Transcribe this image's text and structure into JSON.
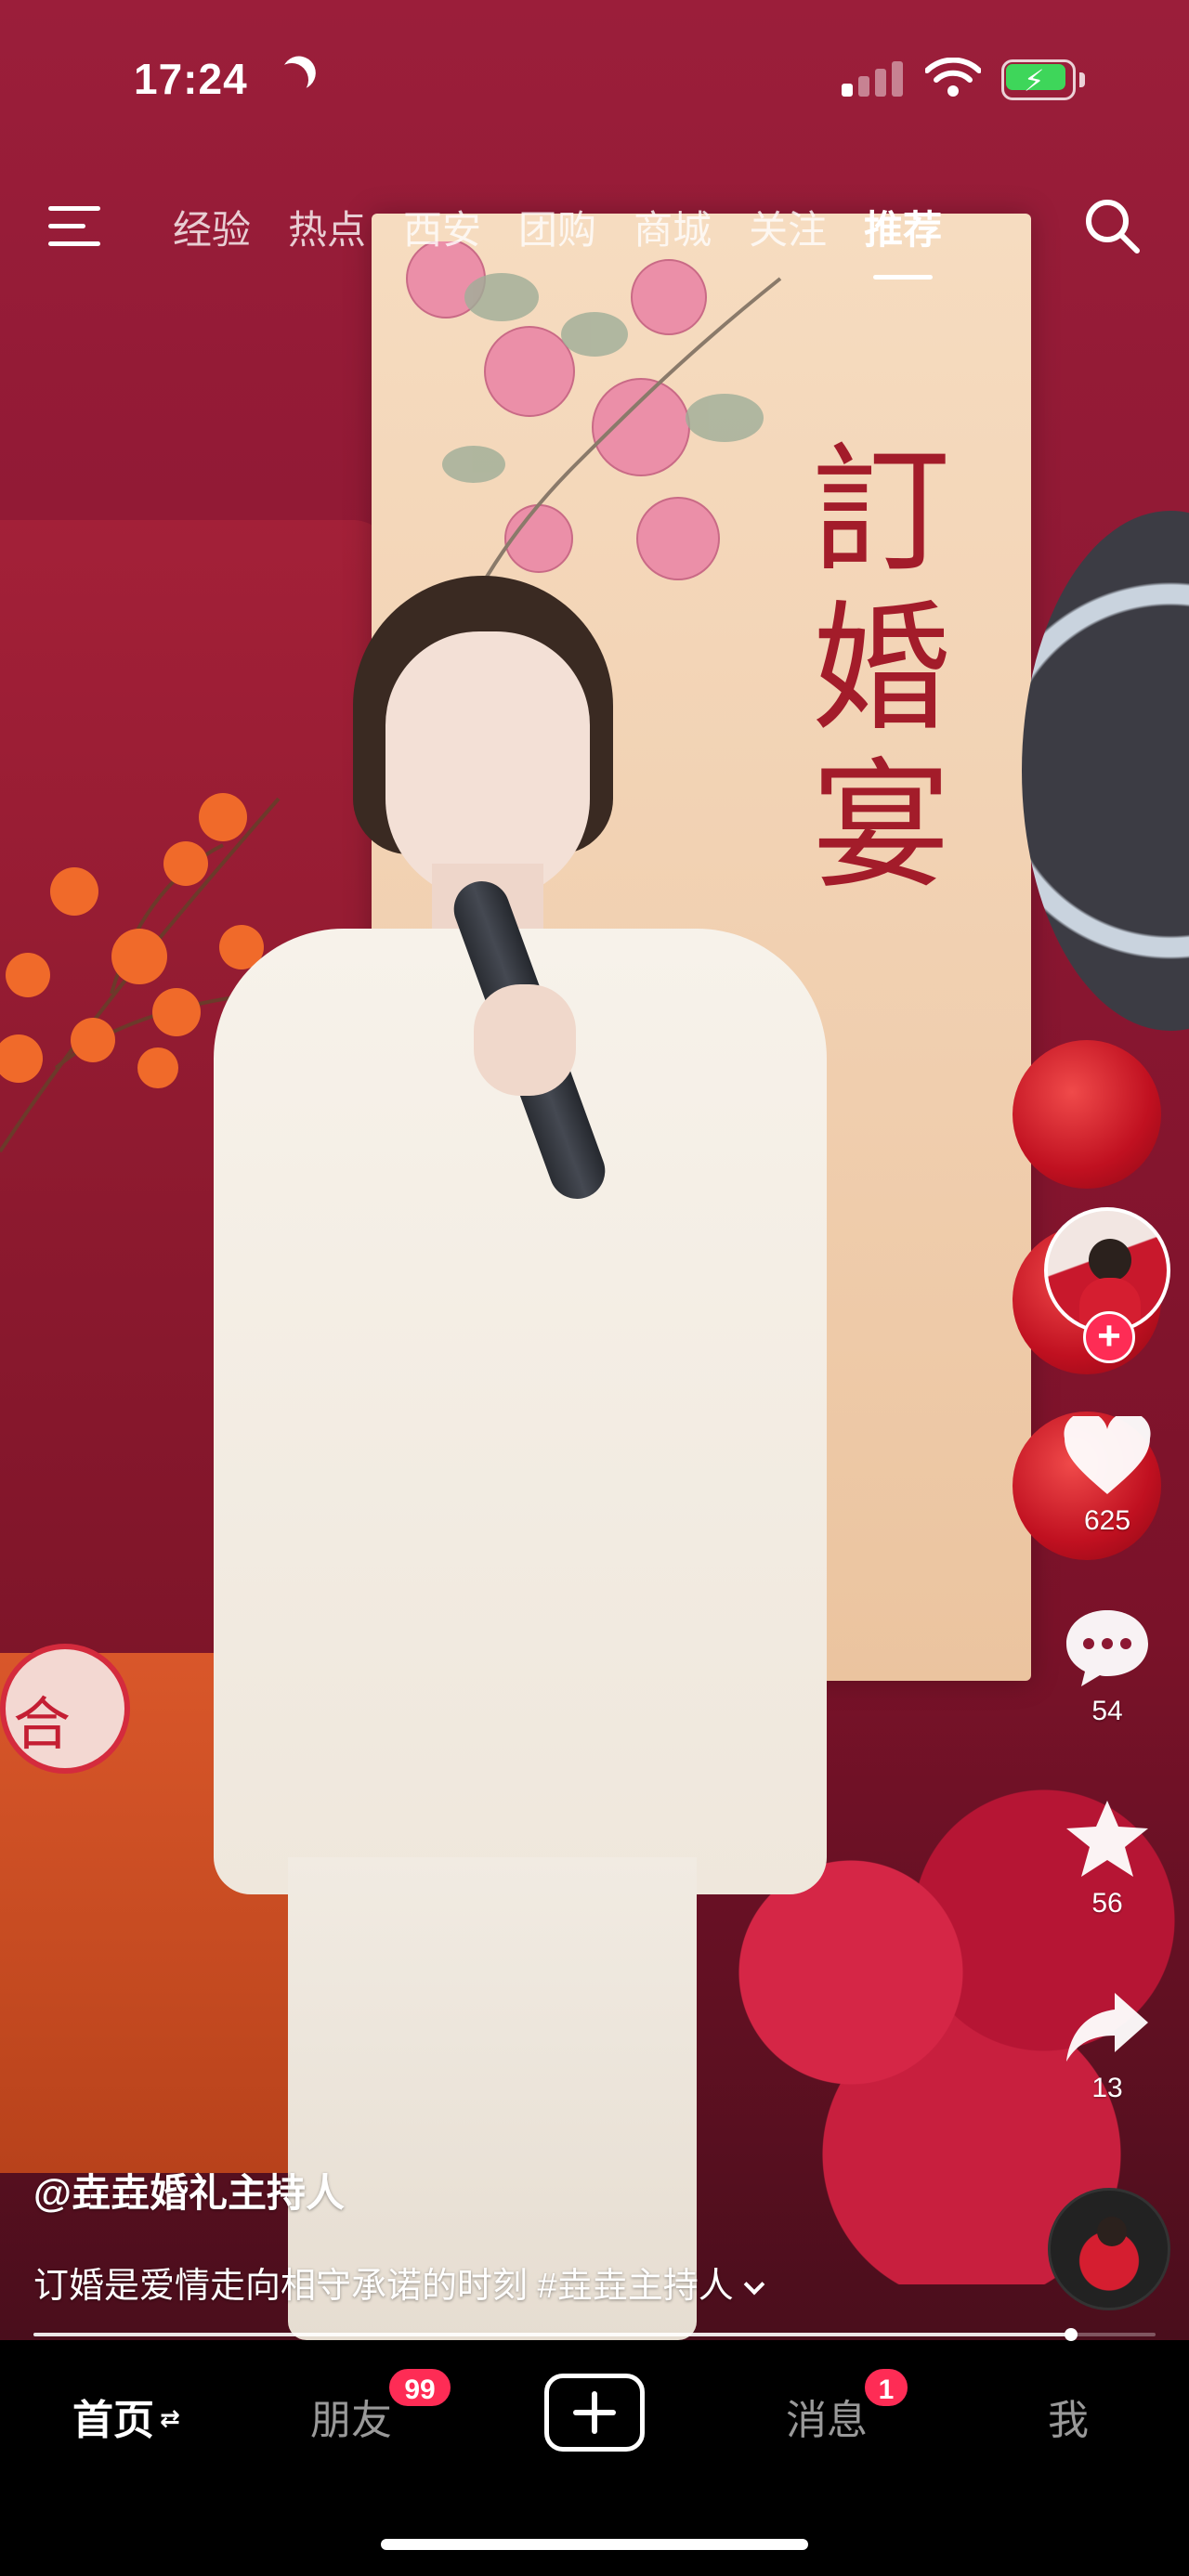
{
  "status_bar": {
    "time": "17:24",
    "battery_color": "#3ed65a"
  },
  "top_nav": {
    "tabs": [
      "经验",
      "热点",
      "西安",
      "团购",
      "商城",
      "关注",
      "推荐"
    ],
    "active_tab": "推荐"
  },
  "video": {
    "banner_text": "訂婚宴",
    "sign_text": "合"
  },
  "actions": {
    "like_count": "625",
    "comment_count": "54",
    "favorite_count": "56",
    "share_count": "13"
  },
  "caption": {
    "author": "@垚垚婚礼主持人",
    "description": "订婚是爱情走向相守承诺的时刻 #垚垚主持人"
  },
  "playback": {
    "progress": 0.925
  },
  "tab_bar": {
    "home": "首页",
    "friends": "朋友",
    "friends_badge": "99",
    "messages": "消息",
    "messages_badge": "1",
    "me": "我"
  },
  "colors": {
    "accent": "#fe2c55",
    "background_red": "#8c1732"
  }
}
